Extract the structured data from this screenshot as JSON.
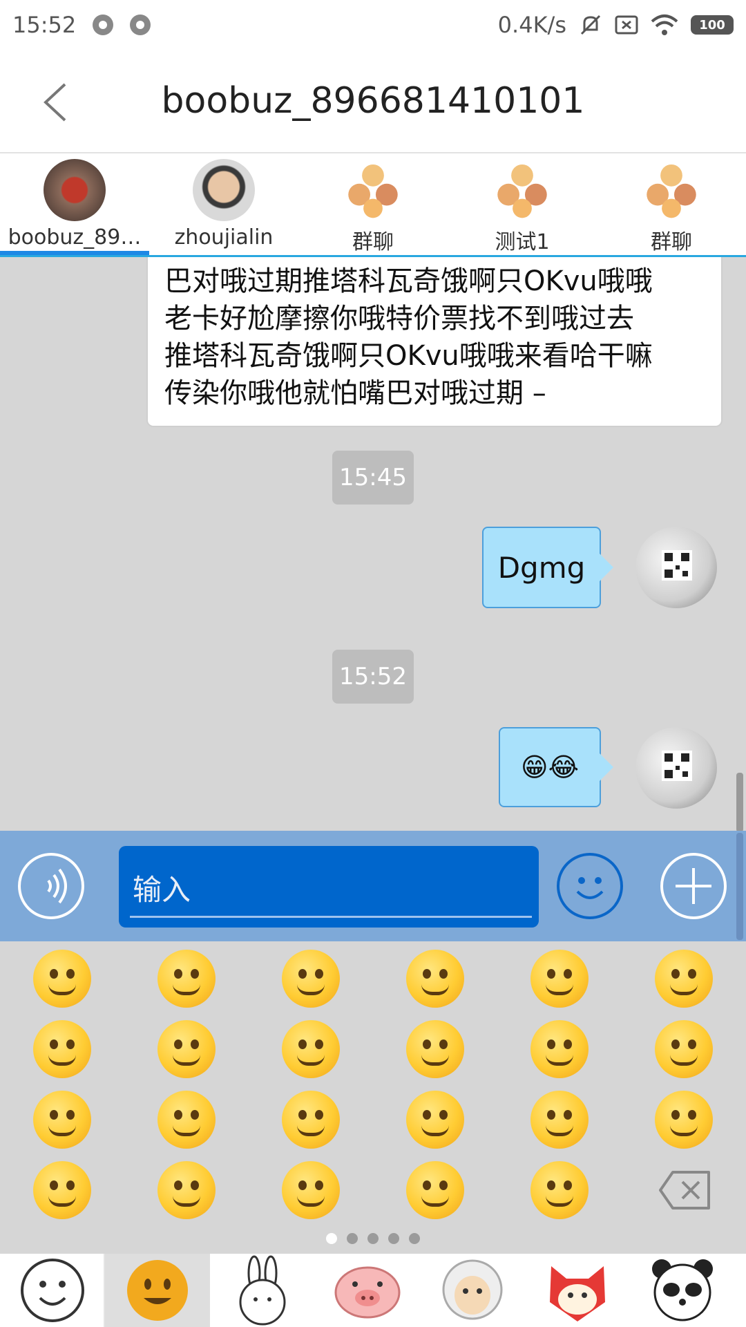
{
  "status_bar": {
    "time": "15:52",
    "net_speed": "0.4K/s",
    "battery": "100"
  },
  "header": {
    "title": "boobuz_896681410101"
  },
  "tabs": [
    {
      "label": "boobuz_89…",
      "icon": "avatar-red-photo"
    },
    {
      "label": "zhoujialin",
      "icon": "avatar-person-photo"
    },
    {
      "label": "群聊",
      "icon": "group-avatar-icon"
    },
    {
      "label": "测试1",
      "icon": "group-avatar-icon"
    },
    {
      "label": "群聊",
      "icon": "group-avatar-icon"
    }
  ],
  "messages": {
    "incoming_lines": [
      "巴对哦过期推塔科瓦奇饿啊只OKvu哦哦",
      "老卡好尬摩擦你哦特价票找不到哦过去",
      "推塔科瓦奇饿啊只OKvu哦哦来看哈干嘛",
      "传染你哦他就怕嘴巴对哦过期 –"
    ],
    "time1": "15:45",
    "out1": "Dgmg",
    "time2": "15:52",
    "out2": "😁😂"
  },
  "input": {
    "placeholder": "输入"
  },
  "emoji_panel": {
    "emojis": [
      "grinning-teeth",
      "tears-of-joy",
      "smiley",
      "grin",
      "sweat-smile",
      "laughing",
      "wink",
      "blush-dizzy",
      "smile",
      "yum",
      "relieved",
      "heart-eyes",
      "smirk",
      "unamused",
      "sweat",
      "pensive",
      "confounded",
      "kissing-heart",
      "kissing-closed-eyes",
      "stuck-out-tongue-wink",
      "stuck-out-tongue-closed-eyes",
      "disappointed",
      "angry",
      "backspace"
    ],
    "page_count": 5,
    "current_page": 1
  },
  "sticker_tabs": [
    "smiley-outline",
    "yellow-face",
    "rabbit",
    "pig",
    "sheep",
    "fox-cat",
    "panda"
  ],
  "colors": {
    "accent": "#1e88e5",
    "bubble_out": "#a9e1fb",
    "input_bar": "#7ea9d8",
    "input_box": "#0066cc"
  }
}
